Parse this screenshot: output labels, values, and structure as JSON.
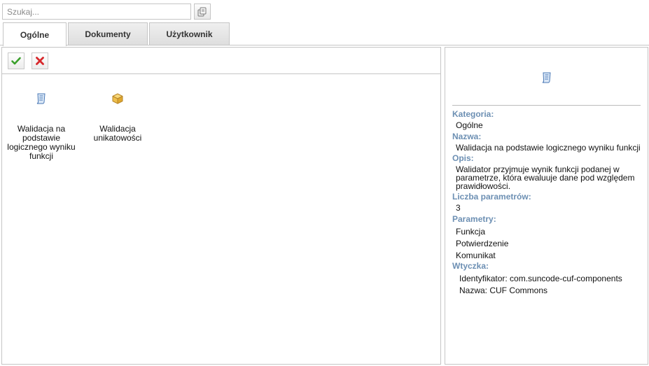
{
  "search": {
    "placeholder": "Szukaj..."
  },
  "tabs": [
    {
      "label": "Ogólne",
      "active": true
    },
    {
      "label": "Dokumenty",
      "active": false
    },
    {
      "label": "Użytkownik",
      "active": false
    }
  ],
  "toolbar": {
    "accept_icon": "check-icon",
    "reject_icon": "x-icon"
  },
  "items": [
    {
      "label": "Walidacja na podstawie logicznego wyniku funkcji",
      "icon": "script-icon"
    },
    {
      "label": "Walidacja unikatowości",
      "icon": "package-icon"
    }
  ],
  "details": {
    "icon": "script-icon",
    "category_label": "Kategoria:",
    "category_value": "Ogólne",
    "name_label": "Nazwa:",
    "name_value": "Walidacja na podstawie logicznego wyniku funkcji",
    "description_label": "Opis:",
    "description_value": "Walidator przyjmuje wynik funkcji podanej w parametrze, która ewaluuje dane pod względem prawidłowości.",
    "param_count_label": "Liczba parametrów:",
    "param_count_value": "3",
    "params_label": "Parametry:",
    "params": [
      "Funkcja",
      "Potwierdzenie",
      "Komunikat"
    ],
    "plugin_label": "Wtyczka:",
    "plugin_id": "Identyfikator: com.suncode-cuf-components",
    "plugin_name": "Nazwa: CUF Commons"
  },
  "colors": {
    "label_blue": "#6c8fb3",
    "border": "#c5c5c5",
    "accept_green": "#3aa02b",
    "reject_red": "#d7282c"
  }
}
